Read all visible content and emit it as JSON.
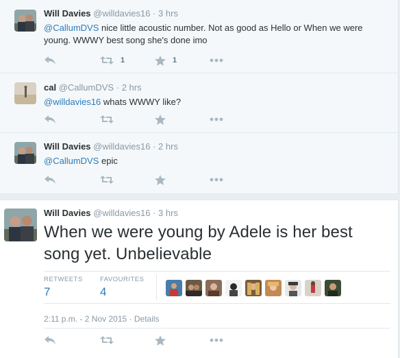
{
  "replies": [
    {
      "fullname": "Will Davies",
      "username": "@willdavies16",
      "separator": "·",
      "time": "3 hrs",
      "mention": "@CallumDVS",
      "text": " nice little acoustic number. Not as good as Hello or When we were young. WWWY best song she's done imo",
      "retweets": "1",
      "favourites": "1"
    },
    {
      "fullname": "cal",
      "username": "@CallumDVS",
      "separator": "·",
      "time": "2 hrs",
      "mention": "@willdavies16",
      "text": " whats WWWY like?",
      "retweets": "",
      "favourites": ""
    },
    {
      "fullname": "Will Davies",
      "username": "@willdavies16",
      "separator": "·",
      "time": "2 hrs",
      "mention": "@CallumDVS",
      "text": " epic",
      "retweets": "",
      "favourites": ""
    }
  ],
  "main_tweet": {
    "fullname": "Will Davies",
    "username": "@willdavies16",
    "separator": "·",
    "time": "3 hrs",
    "text": "When we were young by Adele is her best song yet. Unbelievable",
    "retweets_label": "RETWEETS",
    "retweets": "7",
    "favourites_label": "FAVOURITES",
    "favourites": "4",
    "datetime": "2:11 p.m. - 2 Nov 2015",
    "datetime_separator": " · ",
    "details_label": "Details"
  },
  "colors": {
    "link": "#2b7bb9",
    "muted": "#8899a6",
    "icon": "#aab8c2"
  },
  "icons": [
    "reply-icon",
    "retweet-icon",
    "favorite-icon",
    "more-icon"
  ]
}
